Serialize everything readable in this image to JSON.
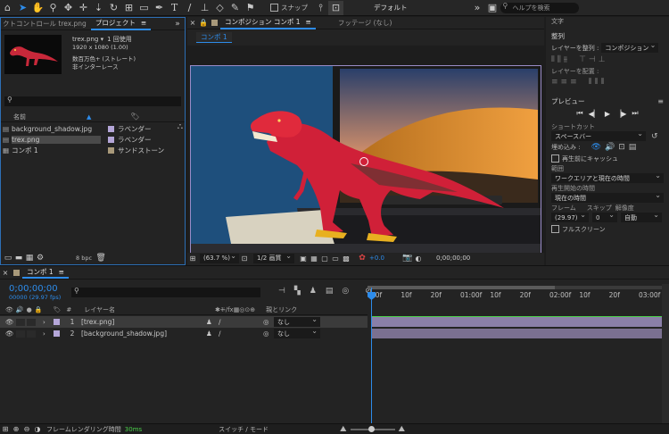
{
  "toolbar": {
    "snap_label": "スナップ",
    "workspace": "デフォルト",
    "search_placeholder": "ヘルプを検索"
  },
  "project_panel": {
    "tab_effect_controls": "クトコントロール trex.png",
    "tab_project": "プロジェクト",
    "selected_name": "trex.png ▾",
    "usage": "1 回使用",
    "dimensions": "1920 x 1080 (1.00)",
    "color_mode": "数百万色+ (ストレート)",
    "interlace": "非インターレース",
    "search_placeholder": "",
    "col_name": "名前",
    "items": [
      {
        "name": "background_shadow.jpg",
        "label": "ラベンダー",
        "color": "#b4a6d8"
      },
      {
        "name": "trex.png",
        "label": "ラベンダー",
        "color": "#b4a6d8"
      },
      {
        "name": "コンポ 1",
        "label": "サンドストーン",
        "color": "#a8997a"
      }
    ],
    "bpc": "8 bpc"
  },
  "comp_panel": {
    "tab_comp": "コンポジション コンポ 1",
    "tab_footage": "フッテージ (なし)",
    "sub_tab": "コンポ 1",
    "zoom": "(63.7 %)",
    "resolution": "1/2 画質",
    "exposure": "+0.0",
    "timecode": "0;00;00;00"
  },
  "right_panel": {
    "title_text": "文字",
    "align": "整列",
    "align_to_label": "レイヤーを整列 :",
    "align_to_value": "コンポジション",
    "distribute_label": "レイヤーを配置 :",
    "preview": "プレビュー",
    "shortcut_label": "ショートカット",
    "shortcut_value": "スペースバー",
    "include_label": "埋め込み :",
    "cache_label": "再生前にキャッシュ",
    "range_label": "範囲",
    "range_value": "ワークエリアと現在の時間",
    "play_from_label": "再生開始の時間",
    "play_from_value": "現在の時間",
    "frame_label": "フレーム",
    "skip_label": "スキップ",
    "res_label": "解像度",
    "fps_value": "(29.97)",
    "skip_value": "0",
    "res_value": "自動",
    "fullscreen_label": "フルスクリーン"
  },
  "timeline": {
    "tab": "コンポ 1",
    "timecode": "0;00;00;00",
    "fps_info": "00000 (29.97 fps)",
    "col_layer_name": "レイヤー名",
    "col_parent": "親とリンク",
    "ruler": [
      "00f",
      "10f",
      "20f",
      "01:00f",
      "10f",
      "20f",
      "02:00f",
      "10f",
      "20f",
      "03:00f"
    ],
    "layers": [
      {
        "num": "1",
        "name": "[trex.png]",
        "parent": "なし",
        "color": "#b4a6d8"
      },
      {
        "num": "2",
        "name": "[background_shadow.jpg]",
        "parent": "なし",
        "color": "#b4a6d8"
      }
    ],
    "render_time_label": "フレームレンダリング時間",
    "render_time_value": "30ms",
    "switch_mode": "スイッチ / モード"
  }
}
